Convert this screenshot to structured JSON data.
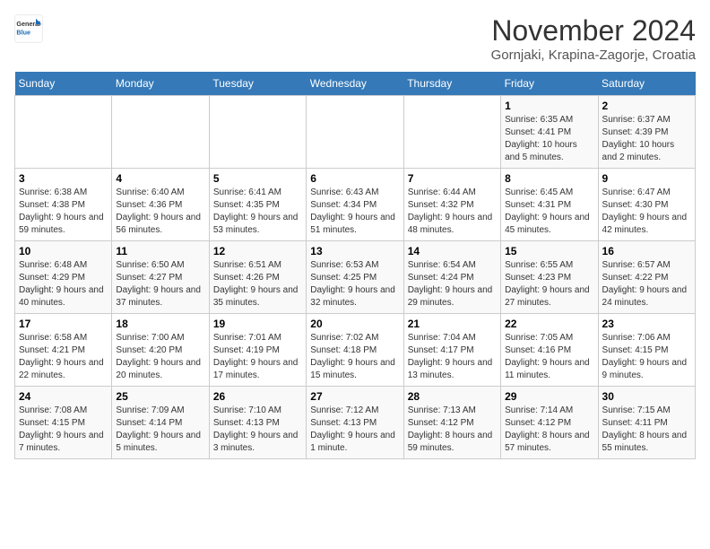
{
  "header": {
    "logo_line1": "General",
    "logo_line2": "Blue",
    "month_title": "November 2024",
    "subtitle": "Gornjaki, Krapina-Zagorje, Croatia"
  },
  "days_of_week": [
    "Sunday",
    "Monday",
    "Tuesday",
    "Wednesday",
    "Thursday",
    "Friday",
    "Saturday"
  ],
  "weeks": [
    [
      {
        "day": "",
        "info": ""
      },
      {
        "day": "",
        "info": ""
      },
      {
        "day": "",
        "info": ""
      },
      {
        "day": "",
        "info": ""
      },
      {
        "day": "",
        "info": ""
      },
      {
        "day": "1",
        "info": "Sunrise: 6:35 AM\nSunset: 4:41 PM\nDaylight: 10 hours and 5 minutes."
      },
      {
        "day": "2",
        "info": "Sunrise: 6:37 AM\nSunset: 4:39 PM\nDaylight: 10 hours and 2 minutes."
      }
    ],
    [
      {
        "day": "3",
        "info": "Sunrise: 6:38 AM\nSunset: 4:38 PM\nDaylight: 9 hours and 59 minutes."
      },
      {
        "day": "4",
        "info": "Sunrise: 6:40 AM\nSunset: 4:36 PM\nDaylight: 9 hours and 56 minutes."
      },
      {
        "day": "5",
        "info": "Sunrise: 6:41 AM\nSunset: 4:35 PM\nDaylight: 9 hours and 53 minutes."
      },
      {
        "day": "6",
        "info": "Sunrise: 6:43 AM\nSunset: 4:34 PM\nDaylight: 9 hours and 51 minutes."
      },
      {
        "day": "7",
        "info": "Sunrise: 6:44 AM\nSunset: 4:32 PM\nDaylight: 9 hours and 48 minutes."
      },
      {
        "day": "8",
        "info": "Sunrise: 6:45 AM\nSunset: 4:31 PM\nDaylight: 9 hours and 45 minutes."
      },
      {
        "day": "9",
        "info": "Sunrise: 6:47 AM\nSunset: 4:30 PM\nDaylight: 9 hours and 42 minutes."
      }
    ],
    [
      {
        "day": "10",
        "info": "Sunrise: 6:48 AM\nSunset: 4:29 PM\nDaylight: 9 hours and 40 minutes."
      },
      {
        "day": "11",
        "info": "Sunrise: 6:50 AM\nSunset: 4:27 PM\nDaylight: 9 hours and 37 minutes."
      },
      {
        "day": "12",
        "info": "Sunrise: 6:51 AM\nSunset: 4:26 PM\nDaylight: 9 hours and 35 minutes."
      },
      {
        "day": "13",
        "info": "Sunrise: 6:53 AM\nSunset: 4:25 PM\nDaylight: 9 hours and 32 minutes."
      },
      {
        "day": "14",
        "info": "Sunrise: 6:54 AM\nSunset: 4:24 PM\nDaylight: 9 hours and 29 minutes."
      },
      {
        "day": "15",
        "info": "Sunrise: 6:55 AM\nSunset: 4:23 PM\nDaylight: 9 hours and 27 minutes."
      },
      {
        "day": "16",
        "info": "Sunrise: 6:57 AM\nSunset: 4:22 PM\nDaylight: 9 hours and 24 minutes."
      }
    ],
    [
      {
        "day": "17",
        "info": "Sunrise: 6:58 AM\nSunset: 4:21 PM\nDaylight: 9 hours and 22 minutes."
      },
      {
        "day": "18",
        "info": "Sunrise: 7:00 AM\nSunset: 4:20 PM\nDaylight: 9 hours and 20 minutes."
      },
      {
        "day": "19",
        "info": "Sunrise: 7:01 AM\nSunset: 4:19 PM\nDaylight: 9 hours and 17 minutes."
      },
      {
        "day": "20",
        "info": "Sunrise: 7:02 AM\nSunset: 4:18 PM\nDaylight: 9 hours and 15 minutes."
      },
      {
        "day": "21",
        "info": "Sunrise: 7:04 AM\nSunset: 4:17 PM\nDaylight: 9 hours and 13 minutes."
      },
      {
        "day": "22",
        "info": "Sunrise: 7:05 AM\nSunset: 4:16 PM\nDaylight: 9 hours and 11 minutes."
      },
      {
        "day": "23",
        "info": "Sunrise: 7:06 AM\nSunset: 4:15 PM\nDaylight: 9 hours and 9 minutes."
      }
    ],
    [
      {
        "day": "24",
        "info": "Sunrise: 7:08 AM\nSunset: 4:15 PM\nDaylight: 9 hours and 7 minutes."
      },
      {
        "day": "25",
        "info": "Sunrise: 7:09 AM\nSunset: 4:14 PM\nDaylight: 9 hours and 5 minutes."
      },
      {
        "day": "26",
        "info": "Sunrise: 7:10 AM\nSunset: 4:13 PM\nDaylight: 9 hours and 3 minutes."
      },
      {
        "day": "27",
        "info": "Sunrise: 7:12 AM\nSunset: 4:13 PM\nDaylight: 9 hours and 1 minute."
      },
      {
        "day": "28",
        "info": "Sunrise: 7:13 AM\nSunset: 4:12 PM\nDaylight: 8 hours and 59 minutes."
      },
      {
        "day": "29",
        "info": "Sunrise: 7:14 AM\nSunset: 4:12 PM\nDaylight: 8 hours and 57 minutes."
      },
      {
        "day": "30",
        "info": "Sunrise: 7:15 AM\nSunset: 4:11 PM\nDaylight: 8 hours and 55 minutes."
      }
    ]
  ]
}
